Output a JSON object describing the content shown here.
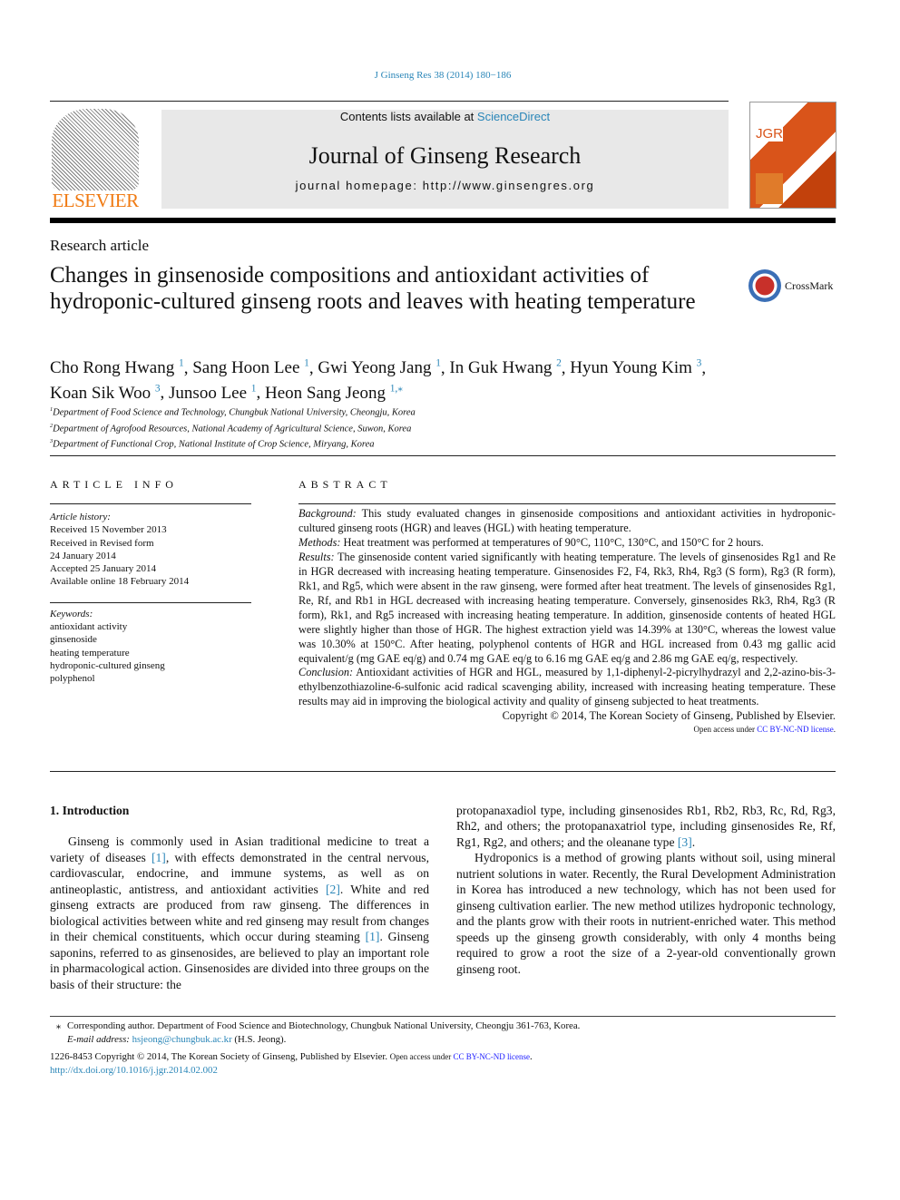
{
  "header": {
    "journal_ref": "J Ginseng Res 38 (2014) 180−186",
    "contents": "Contents lists available at ",
    "sciencedirect": "ScienceDirect",
    "journal_title": "Journal of Ginseng Research",
    "homepage": "journal homepage: http://www.ginsengres.org",
    "publisher_logo": "ELSEVIER",
    "cover_text": "JGR",
    "crossmark": "CrossMark"
  },
  "article": {
    "type": "Research article",
    "title": "Changes in ginsenoside compositions and antioxidant activities of hydroponic-cultured ginseng roots and leaves with heating temperature",
    "authors": [
      {
        "name": "Cho Rong Hwang",
        "sup": "1"
      },
      {
        "name": "Sang Hoon Lee",
        "sup": "1"
      },
      {
        "name": "Gwi Yeong Jang",
        "sup": "1"
      },
      {
        "name": "In Guk Hwang",
        "sup": "2"
      },
      {
        "name": "Hyun Young Kim",
        "sup": "3"
      },
      {
        "name": "Koan Sik Woo",
        "sup": "3"
      },
      {
        "name": "Junsoo Lee",
        "sup": "1"
      },
      {
        "name": "Heon Sang Jeong",
        "sup": "1,⁎"
      }
    ],
    "affiliations": [
      {
        "sup": "1",
        "text": "Department of Food Science and Technology, Chungbuk National University, Cheongju, Korea"
      },
      {
        "sup": "2",
        "text": "Department of Agrofood Resources, National Academy of Agricultural Science, Suwon, Korea"
      },
      {
        "sup": "3",
        "text": "Department of Functional Crop, National Institute of Crop Science, Miryang, Korea"
      }
    ]
  },
  "info": {
    "heading": "ARTICLE INFO",
    "history_label": "Article history:",
    "history": [
      "Received 15 November 2013",
      "Received in Revised form",
      "24 January 2014",
      "Accepted 25 January 2014",
      "Available online 18 February 2014"
    ],
    "keywords_label": "Keywords:",
    "keywords": [
      "antioxidant activity",
      "ginsenoside",
      "heating temperature",
      "hydroponic-cultured ginseng",
      "polyphenol"
    ]
  },
  "abstract": {
    "heading": "ABSTRACT",
    "sections": [
      {
        "label": "Background:",
        "text": " This study evaluated changes in ginsenoside compositions and antioxidant activities in hydroponic-cultured ginseng roots (HGR) and leaves (HGL) with heating temperature."
      },
      {
        "label": "Methods:",
        "text": " Heat treatment was performed at temperatures of 90°C, 110°C, 130°C, and 150°C for 2 hours."
      },
      {
        "label": "Results:",
        "text": " The ginsenoside content varied significantly with heating temperature. The levels of ginsenosides Rg1 and Re in HGR decreased with increasing heating temperature. Ginsenosides F2, F4, Rk3, Rh4, Rg3 (S form), Rg3 (R form), Rk1, and Rg5, which were absent in the raw ginseng, were formed after heat treatment. The levels of ginsenosides Rg1, Re, Rf, and Rb1 in HGL decreased with increasing heating temperature. Conversely, ginsenosides Rk3, Rh4, Rg3 (R form), Rk1, and Rg5 increased with increasing heating temperature. In addition, ginsenoside contents of heated HGL were slightly higher than those of HGR. The highest extraction yield was 14.39% at 130°C, whereas the lowest value was 10.30% at 150°C. After heating, polyphenol contents of HGR and HGL increased from 0.43 mg gallic acid equivalent/g (mg GAE eq/g) and 0.74 mg GAE eq/g to 6.16 mg GAE eq/g and 2.86 mg GAE eq/g, respectively."
      },
      {
        "label": "Conclusion:",
        "text": " Antioxidant activities of HGR and HGL, measured by 1,1-diphenyl-2-picrylhydrazyl and 2,2-azino-bis-3-ethylbenzothiazoline-6-sulfonic acid radical scavenging ability, increased with increasing heating temperature. These results may aid in improving the biological activity and quality of ginseng subjected to heat treatments."
      }
    ],
    "copyright": "Copyright © 2014, The Korean Society of Ginseng, Published by Elsevier.",
    "open_access": "Open access under ",
    "license": "CC BY-NC-ND license",
    "period": "."
  },
  "intro": {
    "heading": "1.  Introduction",
    "paragraphs": [
      [
        {
          "t": "Ginseng is commonly used in Asian traditional medicine to treat a variety of diseases "
        },
        {
          "t": "[1]",
          "ref": true
        },
        {
          "t": ", with effects demonstrated in the central nervous, cardiovascular, endocrine, and immune systems, as well as on antineoplastic, antistress, and antioxidant activities "
        },
        {
          "t": "[2]",
          "ref": true
        },
        {
          "t": ". White and red ginseng extracts are produced from raw ginseng. The differences in biological activities between white and red ginseng may result from changes in their chemical constituents, which occur during steaming "
        },
        {
          "t": "[1]",
          "ref": true
        },
        {
          "t": ". Ginseng saponins, referred to as ginsenosides, are believed to play an important role in pharmacological action. Ginsenosides are divided into three groups on the basis of their structure: the"
        }
      ]
    ],
    "right_paragraphs": [
      [
        {
          "t": "protopanaxadiol type, including ginsenosides Rb1, Rb2, Rb3, Rc, Rd, Rg3, Rh2, and others; the protopanaxatriol type, including ginsenosides Re, Rf, Rg1, Rg2, and others; and the oleanane type "
        },
        {
          "t": "[3]",
          "ref": true
        },
        {
          "t": "."
        }
      ],
      [
        {
          "t": "Hydroponics is a method of growing plants without soil, using mineral nutrient solutions in water. Recently, the Rural Development Administration in Korea has introduced a new technology, which has not been used for ginseng cultivation earlier. The new method utilizes hydroponic technology, and the plants grow with their roots in nutrient-enriched water. This method speeds up the ginseng growth considerably, with only 4 months being required to grow a root the size of a 2-year-old conventionally grown ginseng root."
        }
      ]
    ]
  },
  "footer": {
    "star": "⁎",
    "corresponding": "Corresponding author. Department of Food Science and Biotechnology, Chungbuk National University, Cheongju 361-763, Korea.",
    "email_label": "E-mail address:",
    "email": "hsjeong@chungbuk.ac.kr",
    "email_suffix": " (H.S. Jeong).",
    "issn_copyright": "1226-8453  Copyright © 2014, The Korean Society of Ginseng, Published by Elsevier. ",
    "open_access": "Open access under ",
    "license": "CC BY-NC-ND license",
    "period": ".",
    "doi": "http://dx.doi.org/10.1016/j.jgr.2014.02.002"
  },
  "colors": {
    "link": "#2a86b8",
    "license": "#1a1aff",
    "elsevier": "#f07a12",
    "header_box": "#e8e8e8"
  }
}
